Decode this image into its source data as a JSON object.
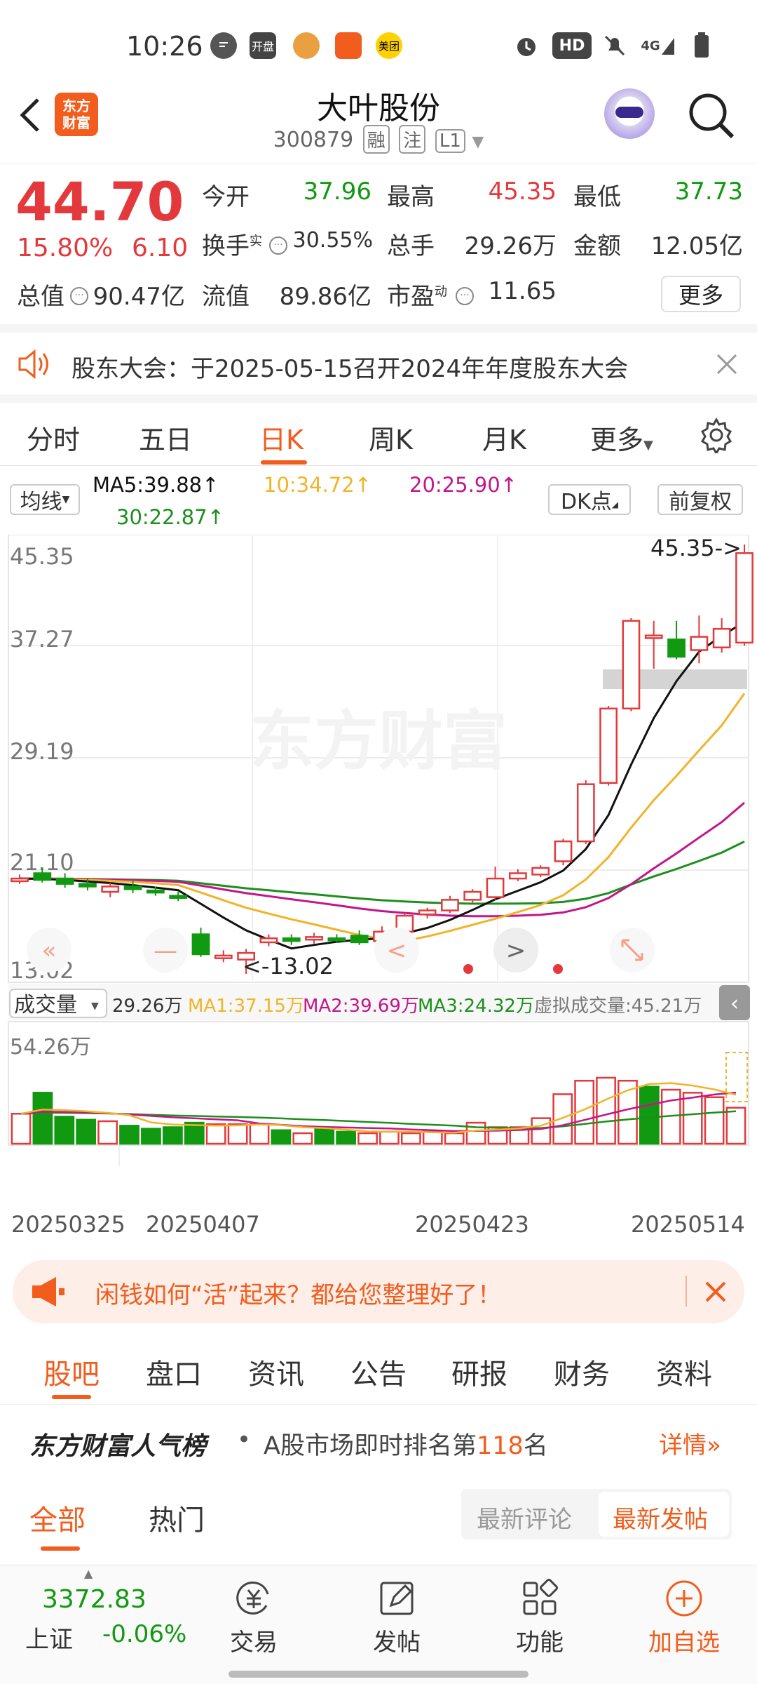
{
  "status_bar": {
    "time": "10:26",
    "icons": [
      "chat-icon",
      "kaipan-app-icon",
      "mascot-app-icon",
      "figure-app-icon",
      "meituan-app-icon",
      "alarm-icon",
      "hd-icon",
      "mute-icon",
      "signal-4g-icon",
      "battery-icon"
    ],
    "kaipan_label": "开盘",
    "meituan_label": "美团",
    "hd_label": "HD",
    "net_label": "4G"
  },
  "header": {
    "back_icon": "back-arrow-icon",
    "logo_text_1": "东方",
    "logo_text_2": "财富",
    "stock_name": "大叶股份",
    "stock_code": "300879",
    "tags": [
      "融",
      "注",
      "L1"
    ],
    "avatar": "robot-avatar-icon",
    "search_icon": "search-icon"
  },
  "quote": {
    "price": "44.70",
    "change_pct": "15.80%",
    "change": "6.10",
    "open_label": "今开",
    "open": "37.96",
    "high_label": "最高",
    "high": "45.35",
    "low_label": "最低",
    "low": "37.73",
    "turnover_label": "换手",
    "turnover_sup": "实",
    "turnover": "30.55%",
    "volume_label": "总手",
    "volume": "29.26万",
    "amount_label": "金额",
    "amount": "12.05亿",
    "mktcap_label": "总值",
    "mktcap": "90.47亿",
    "float_label": "流值",
    "float": "89.86亿",
    "pe_label": "市盈",
    "pe_sup": "动",
    "pe": "11.65",
    "more_label": "更多"
  },
  "notice": {
    "text": "股东大会：于2025-05-15召开2024年年度股东大会"
  },
  "chart_tabs": {
    "items": [
      "分时",
      "五日",
      "日K",
      "周K",
      "月K",
      "更多"
    ],
    "active": "日K"
  },
  "ma_legend": {
    "selector": "均线",
    "ma5": "MA5:39.88",
    "ma10": "10:34.72",
    "ma20": "20:25.90",
    "ma30": "30:22.87",
    "dk_label": "DK点",
    "adjust_label": "前复权"
  },
  "colors": {
    "up": "#e4393c",
    "down": "#119911",
    "accent": "#f25c1c",
    "ma5": "#111111",
    "ma10": "#f0b429",
    "ma20": "#c2168a",
    "ma30": "#1c8f1c"
  },
  "chart_data": {
    "type": "candlestick",
    "y_axis_labels": [
      "45.35",
      "37.27",
      "29.19",
      "21.10",
      "13.02"
    ],
    "ylim": [
      13.02,
      45.35
    ],
    "high_marker": "45.35->",
    "low_marker": "<-13.02",
    "watermark": "东方财富",
    "candles": [
      {
        "o": 20.0,
        "c": 20.2,
        "h": 20.5,
        "l": 19.8
      },
      {
        "o": 20.6,
        "c": 20.1,
        "h": 21.0,
        "l": 19.9
      },
      {
        "o": 20.2,
        "c": 19.8,
        "h": 20.6,
        "l": 19.5
      },
      {
        "o": 19.8,
        "c": 19.6,
        "h": 20.2,
        "l": 19.3
      },
      {
        "o": 19.2,
        "c": 19.6,
        "h": 19.9,
        "l": 18.8
      },
      {
        "o": 19.6,
        "c": 19.4,
        "h": 20.0,
        "l": 19.1
      },
      {
        "o": 19.3,
        "c": 19.2,
        "h": 19.6,
        "l": 18.9
      },
      {
        "o": 18.9,
        "c": 18.8,
        "h": 19.2,
        "l": 18.5
      },
      {
        "o": 16.0,
        "c": 14.5,
        "h": 16.5,
        "l": 14.3
      },
      {
        "o": 14.2,
        "c": 14.4,
        "h": 14.8,
        "l": 13.9
      },
      {
        "o": 14.1,
        "c": 14.6,
        "h": 14.9,
        "l": 13.02
      },
      {
        "o": 15.4,
        "c": 15.7,
        "h": 16.0,
        "l": 15.1
      },
      {
        "o": 15.7,
        "c": 15.5,
        "h": 16.0,
        "l": 15.2
      },
      {
        "o": 15.6,
        "c": 15.8,
        "h": 16.1,
        "l": 15.3
      },
      {
        "o": 15.7,
        "c": 15.6,
        "h": 16.0,
        "l": 15.4
      },
      {
        "o": 15.9,
        "c": 15.4,
        "h": 16.3,
        "l": 15.2
      },
      {
        "o": 15.5,
        "c": 16.2,
        "h": 16.6,
        "l": 15.3
      },
      {
        "o": 16.2,
        "c": 17.4,
        "h": 17.6,
        "l": 16.0
      },
      {
        "o": 17.5,
        "c": 17.8,
        "h": 18.0,
        "l": 17.2
      },
      {
        "o": 17.8,
        "c": 18.6,
        "h": 18.9,
        "l": 17.6
      },
      {
        "o": 18.6,
        "c": 19.2,
        "h": 19.4,
        "l": 18.4
      },
      {
        "o": 18.8,
        "c": 20.2,
        "h": 21.1,
        "l": 18.6
      },
      {
        "o": 20.2,
        "c": 20.6,
        "h": 20.9,
        "l": 20.0
      },
      {
        "o": 20.5,
        "c": 21.0,
        "h": 21.2,
        "l": 20.3
      },
      {
        "o": 21.5,
        "c": 23.0,
        "h": 23.2,
        "l": 21.2
      },
      {
        "o": 23.0,
        "c": 27.3,
        "h": 27.6,
        "l": 22.8
      },
      {
        "o": 27.4,
        "c": 33.0,
        "h": 33.2,
        "l": 27.2
      },
      {
        "o": 33.0,
        "c": 39.6,
        "h": 39.8,
        "l": 32.8
      },
      {
        "o": 38.3,
        "c": 38.5,
        "h": 39.6,
        "l": 36.0
      },
      {
        "o": 38.2,
        "c": 36.9,
        "h": 39.6,
        "l": 36.7
      },
      {
        "o": 37.4,
        "c": 38.4,
        "h": 40.0,
        "l": 36.4
      },
      {
        "o": 37.6,
        "c": 39.0,
        "h": 39.8,
        "l": 37.2
      },
      {
        "o": 37.96,
        "c": 44.7,
        "h": 45.35,
        "l": 37.73
      }
    ],
    "volume": {
      "label": "成交量",
      "value": "29.26万",
      "ma1": "MA1:37.15万",
      "ma2": "MA2:39.69万",
      "ma3": "MA3:24.32万",
      "virtual": "虚拟成交量:45.21万",
      "y_max_label": "54.26万",
      "bars_wan": [
        20,
        34,
        18,
        16,
        15,
        12,
        10,
        11,
        14,
        13,
        13,
        13,
        9,
        7,
        10,
        8,
        7,
        8,
        7,
        8,
        7,
        14,
        11,
        11,
        17,
        33,
        42,
        44,
        42,
        38,
        36,
        34,
        31,
        24
      ],
      "x_labels": [
        "20250325",
        "20250407",
        "20250423",
        "20250514"
      ]
    }
  },
  "promo": {
    "text": "闲钱如何“活”起来？都给您整理好了！"
  },
  "bottom_tabs": {
    "items": [
      "股吧",
      "盘口",
      "资讯",
      "公告",
      "研报",
      "财务",
      "资料"
    ],
    "active": "股吧"
  },
  "rank": {
    "title": "东方财富人气榜",
    "text_prefix": "A股市场即时排名第",
    "rank_num": "118",
    "text_suffix": "名",
    "detail": "详情"
  },
  "filter": {
    "tabs": [
      "全部",
      "热门"
    ],
    "active": "全部",
    "sort": [
      "最新评论",
      "最新发帖"
    ],
    "sort_active": "最新发帖"
  },
  "bottom_nav": {
    "index_value": "3372.83",
    "index_name": "上证",
    "index_change": "-0.06%",
    "items": [
      "交易",
      "发帖",
      "功能",
      "加自选"
    ]
  }
}
